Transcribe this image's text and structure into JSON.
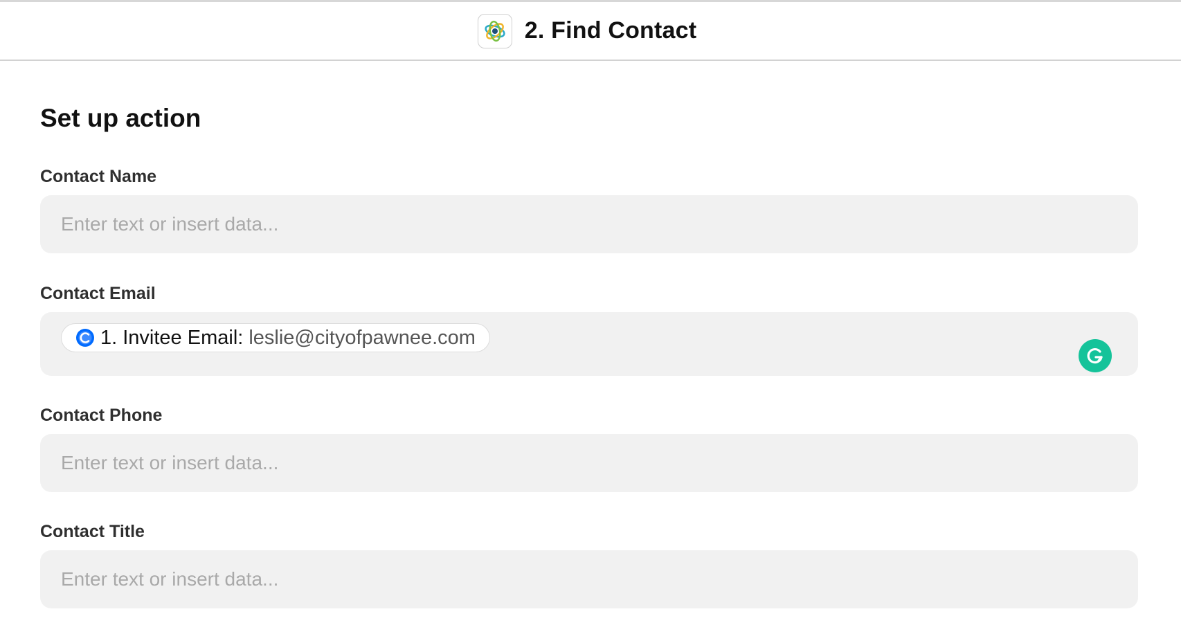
{
  "header": {
    "title": "2. Find Contact",
    "app_icon": "orbit-app-icon"
  },
  "main": {
    "section_title": "Set up action",
    "fields": [
      {
        "label": "Contact Name",
        "placeholder": "Enter text or insert data..."
      },
      {
        "label": "Contact Email",
        "token": {
          "icon": "calendly-icon",
          "key": "1. Invitee Email:",
          "value": "leslie@cityofpawnee.com"
        },
        "assistant_icon": "grammarly-icon"
      },
      {
        "label": "Contact Phone",
        "placeholder": "Enter text or insert data..."
      },
      {
        "label": "Contact Title",
        "placeholder": "Enter text or insert data..."
      }
    ]
  },
  "colors": {
    "field_background": "#f1f1f1",
    "placeholder": "#a9a9a9",
    "grammarly_green": "#15c39a",
    "calendly_blue": "#006bff"
  }
}
